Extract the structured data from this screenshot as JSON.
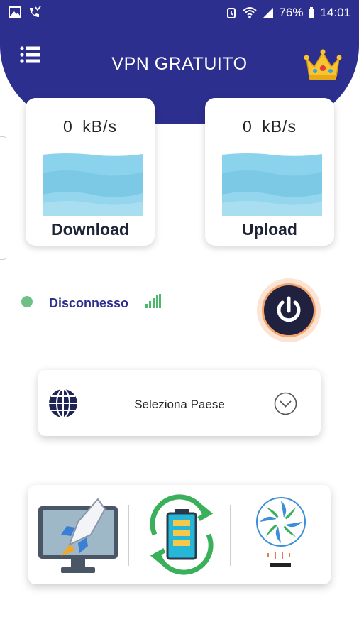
{
  "status_bar": {
    "battery_percent": "76%",
    "time": "14:01"
  },
  "header": {
    "title": "VPN GRATUITO",
    "menu_icon": "hamburger-menu-icon",
    "premium_icon": "crown-icon"
  },
  "speed": {
    "download": {
      "value": "0 kB/s",
      "label": "Download"
    },
    "upload": {
      "value": "0 kB/s",
      "label": "Upload"
    }
  },
  "connection": {
    "status": "Disconnesso",
    "status_color": "#6fbf86",
    "power_icon": "power-icon"
  },
  "country_select": {
    "label": "Seleziona Paese",
    "icon": "globe-icon"
  },
  "tools": [
    {
      "icon": "rocket-boost-icon"
    },
    {
      "icon": "battery-saver-icon"
    },
    {
      "icon": "cpu-cooler-icon"
    }
  ],
  "colors": {
    "primary": "#2d2f8f",
    "accent_orange": "#f3a56b",
    "wave_blue": "#7fd0ea"
  }
}
